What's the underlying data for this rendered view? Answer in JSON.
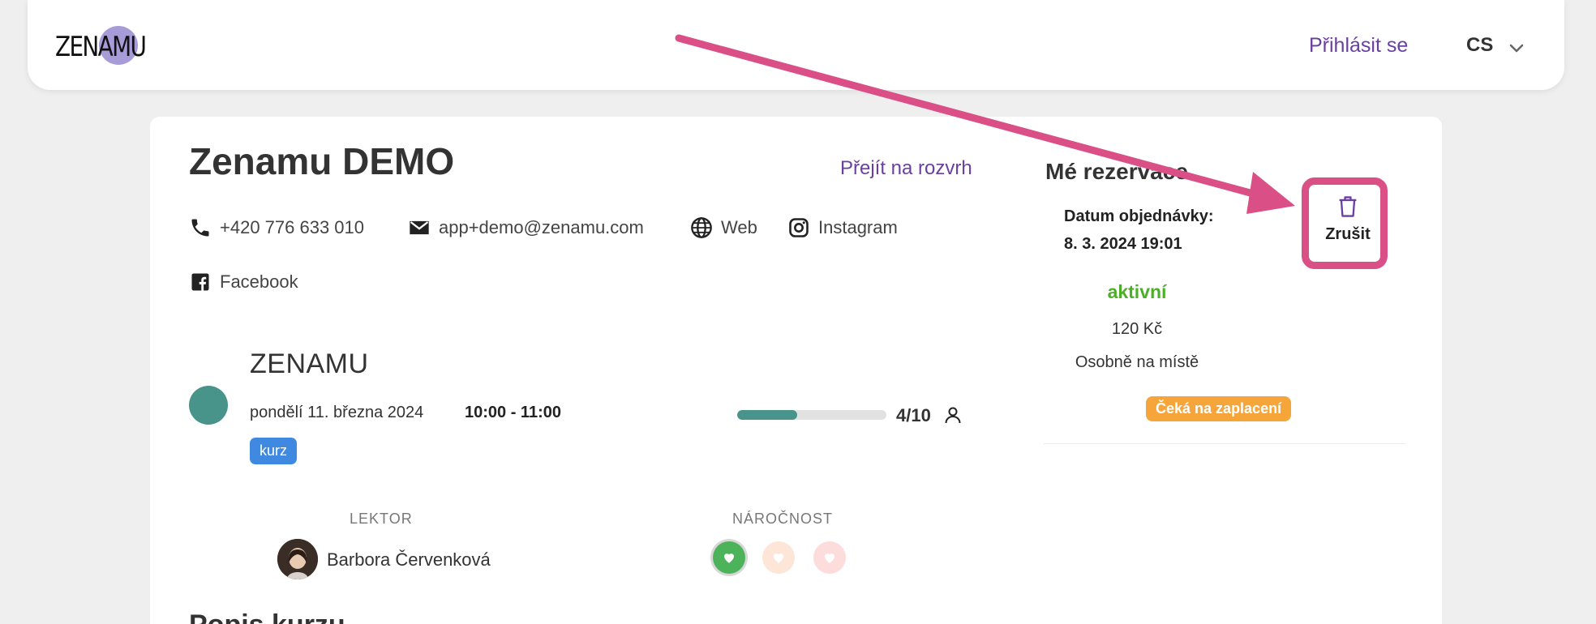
{
  "header": {
    "logo_text": "ZENAMU",
    "login_label": "Přihlásit se",
    "language": "CS"
  },
  "studio": {
    "title": "Zenamu DEMO",
    "schedule_link": "Přejít na rozvrh",
    "phone": "+420 776 633 010",
    "email": "app+demo@zenamu.com",
    "web": "Web",
    "instagram": "Instagram",
    "facebook": "Facebook"
  },
  "event": {
    "name": "ZENAMU",
    "date": "pondělí 11. března 2024",
    "time": "10:00 - 11:00",
    "tag": "kurz",
    "capacity_text": "4/10",
    "capacity_fraction": 0.4,
    "lector_label": "LEKTOR",
    "lector_name": "Barbora Červenková",
    "difficulty_label": "NÁROČNOST",
    "difficulty_level": 1,
    "next_heading": "Popis kurzu"
  },
  "reservation": {
    "title": "Mé rezervace",
    "order_label": "Datum objednávky:",
    "order_date": "8. 3. 2024 19:01",
    "cancel_label": "Zrušit",
    "status": "aktivní",
    "price": "120 Kč",
    "payment": "Osobně na místě",
    "badge": "Čeká na zaplacení"
  },
  "colors": {
    "accent": "#6b3fa0",
    "highlight": "#d94f86",
    "event": "#48938a",
    "status": "#4caf27",
    "badge": "#f5a53a",
    "tag": "#3f8ae0"
  }
}
